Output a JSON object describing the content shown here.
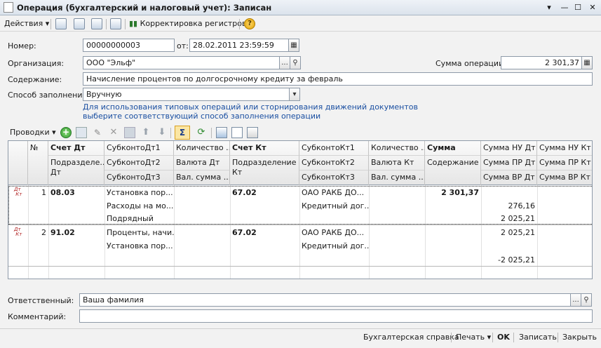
{
  "window": {
    "title": "Операция (бухгалтерский и налоговый учет): Записан"
  },
  "toolbar": {
    "actions_label": "Действия",
    "corrections_label": "Корректировка регистров",
    "help_label": "?"
  },
  "form": {
    "number_label": "Номер:",
    "number_value": "00000000003",
    "date_label": "от:",
    "date_value": "28.02.2011 23:59:59",
    "org_label": "Организация:",
    "org_value": "ООО \"Эльф\"",
    "sum_label": "Сумма операции:",
    "sum_value": "2 301,37",
    "content_label": "Содержание:",
    "content_value": "Начисление процентов по долгосрочному кредиту за февраль",
    "fill_label": "Способ заполнения:",
    "fill_value": "Вручную",
    "hint_line1": "Для использования типовых операций или сторнирования движений документов",
    "hint_line2": "выберите соответствующий способ заполнения операции"
  },
  "entries_toolbar": {
    "label": "Проводки"
  },
  "grid": {
    "headers": {
      "r1": [
        "№",
        "Счет Дт",
        "СубконтоДт1",
        "Количество ...",
        "Счет Кт",
        "СубконтоКт1",
        "Количество ...",
        "Сумма",
        "Сумма НУ Дт",
        "Сумма НУ Кт"
      ],
      "r2": [
        "Подразделе... Дт",
        "СубконтоДт2",
        "Валюта Дт",
        "Подразделение Кт",
        "СубконтоКт2",
        "Валюта Кт",
        "Содержание",
        "Сумма ПР Дт",
        "Сумма ПР Кт"
      ],
      "r3": [
        "СубконтоДт3",
        "Вал. сумма ...",
        "СубконтоКт3",
        "Вал. сумма ...",
        "Сумма ВР Дт",
        "Сумма ВР Кт"
      ]
    },
    "rows": [
      {
        "num": "1",
        "dt": "08.03",
        "kt": "67.02",
        "sum": "2 301,37",
        "sub_dt1": "Установка пор...",
        "sub_dt2": "Расходы на мо...",
        "sub_dt3": "Подрядный",
        "sub_kt1": "ОАО РАКБ ДО...",
        "sub_kt2": "Кредитный дог...",
        "pr_dt": "276,16",
        "vr_dt": "2 025,21"
      },
      {
        "num": "2",
        "dt": "91.02",
        "kt": "67.02",
        "sub_dt1": "Проценты, начи...",
        "sub_dt2": "Установка пор...",
        "sub_kt1": "ОАО РАКБ ДО...",
        "sub_kt2": "Кредитный дог...",
        "nu_dt": "2 025,21",
        "vr_dt": "-2 025,21"
      }
    ]
  },
  "footer": {
    "resp_label": "Ответственный:",
    "resp_value": "Ваша фамилия",
    "comment_label": "Комментарий:",
    "comment_value": ""
  },
  "bottom": {
    "report_label": "Бухгалтерская справка",
    "print_label": "Печать",
    "ok_label": "OK",
    "save_label": "Записать",
    "close_label": "Закрыть"
  }
}
